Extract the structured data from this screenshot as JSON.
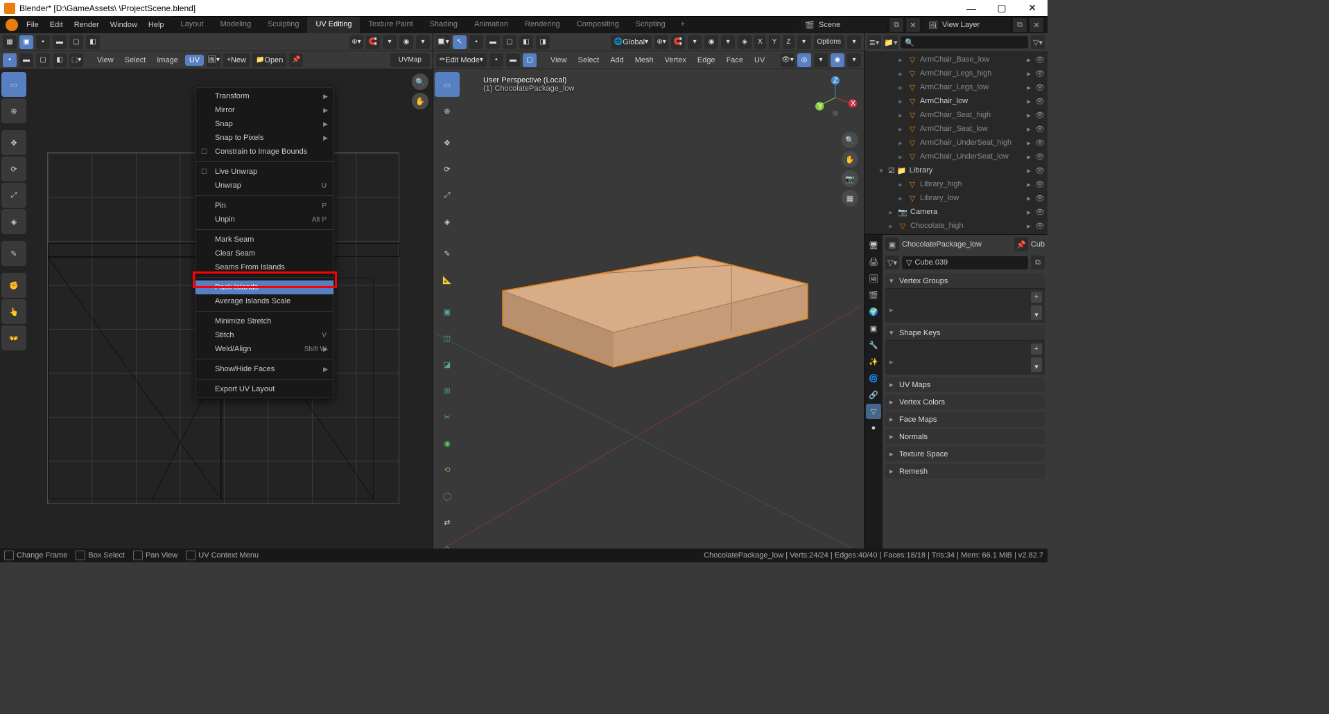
{
  "title": "Blender* [D:\\GameAssets\\                 \\ProjectScene.blend]",
  "window_controls": {
    "min": "—",
    "max": "▢",
    "close": "✕"
  },
  "main_menu": [
    "File",
    "Edit",
    "Render",
    "Window",
    "Help"
  ],
  "workspace_tabs": [
    "Layout",
    "Modeling",
    "Sculpting",
    "UV Editing",
    "Texture Paint",
    "Shading",
    "Animation",
    "Rendering",
    "Compositing",
    "Scripting"
  ],
  "workspace_active": "UV Editing",
  "scene_name": "Scene",
  "layer_name": "View Layer",
  "uv_header": {
    "menus": [
      "View",
      "Select",
      "Image",
      "UV"
    ],
    "new": "New",
    "open": "Open",
    "map": "UVMap"
  },
  "uv_dropdown": {
    "items": [
      {
        "label": "Transform",
        "sub": true
      },
      {
        "label": "Mirror",
        "sub": true
      },
      {
        "label": "Snap",
        "sub": true
      },
      {
        "label": "Snap to Pixels",
        "sub": true
      },
      {
        "label": "Constrain to Image Bounds",
        "check": true
      },
      {
        "divider": true
      },
      {
        "label": "Live Unwrap",
        "check": true
      },
      {
        "label": "Unwrap",
        "shortcut": "U"
      },
      {
        "divider": true
      },
      {
        "label": "Pin",
        "shortcut": "P"
      },
      {
        "label": "Unpin",
        "shortcut": "Alt P"
      },
      {
        "divider": true
      },
      {
        "label": "Mark Seam"
      },
      {
        "label": "Clear Seam"
      },
      {
        "label": "Seams From Islands"
      },
      {
        "divider": true
      },
      {
        "label": "Pack Islands",
        "hl": true
      },
      {
        "label": "Average Islands Scale"
      },
      {
        "divider": true
      },
      {
        "label": "Minimize Stretch"
      },
      {
        "label": "Stitch",
        "shortcut": "V"
      },
      {
        "label": "Weld/Align",
        "shortcut": "Shift W",
        "sub": true
      },
      {
        "divider": true
      },
      {
        "label": "Show/Hide Faces",
        "sub": true
      },
      {
        "divider": true
      },
      {
        "label": "Export UV Layout"
      }
    ]
  },
  "vp_header": {
    "mode": "Edit Mode",
    "menus": [
      "View",
      "Select",
      "Add",
      "Mesh",
      "Vertex",
      "Edge",
      "Face",
      "UV"
    ],
    "orient": "Global",
    "options": "Options"
  },
  "vp_overlay": {
    "line1": "User Perspective (Local)",
    "line2": "(1) ChocolatePackage_low"
  },
  "outliner": {
    "items": [
      {
        "indent": 3,
        "label": "ArmChair_Base_low",
        "icons": true,
        "dim": true
      },
      {
        "indent": 3,
        "label": "ArmChair_Legs_high",
        "icons": true,
        "dim": true
      },
      {
        "indent": 3,
        "label": "ArmChair_Legs_low",
        "icons": true,
        "dim": true
      },
      {
        "indent": 3,
        "label": "ArmChair_low",
        "icons": true,
        "active": true
      },
      {
        "indent": 3,
        "label": "ArmChair_Seat_high",
        "icons": true,
        "dim": true
      },
      {
        "indent": 3,
        "label": "ArmChair_Seat_low",
        "icons": true,
        "dim": true
      },
      {
        "indent": 3,
        "label": "ArmChair_UnderSeat_high",
        "icons": true,
        "dim": true
      },
      {
        "indent": 3,
        "label": "ArmChair_UnderSeat_low",
        "icons": true,
        "dim": true
      },
      {
        "indent": 1,
        "label": "Library",
        "collection": true,
        "exp": true
      },
      {
        "indent": 3,
        "label": "Library_high",
        "icons": true,
        "dim": true
      },
      {
        "indent": 3,
        "label": "Library_low",
        "icons": true,
        "dim": true
      },
      {
        "indent": 2,
        "label": "Camera",
        "camera": true
      },
      {
        "indent": 2,
        "label": "Chocolate_high",
        "icons": true,
        "dim": true
      }
    ]
  },
  "props": {
    "object_name": "ChocolatePackage_low",
    "data_name": "Cube.039",
    "pin": "Cub",
    "sections": [
      {
        "label": "Vertex Groups",
        "open": true
      },
      {
        "label": "Shape Keys",
        "open": true
      },
      {
        "label": "UV Maps",
        "open": false
      },
      {
        "label": "Vertex Colors",
        "open": false
      },
      {
        "label": "Face Maps",
        "open": false
      },
      {
        "label": "Normals",
        "open": false
      },
      {
        "label": "Texture Space",
        "open": false
      },
      {
        "label": "Remesh",
        "open": false
      }
    ]
  },
  "status": {
    "left": [
      {
        "label": "Change Frame"
      },
      {
        "label": "Box Select"
      },
      {
        "label": "Pan View"
      },
      {
        "label": "UV Context Menu"
      }
    ],
    "right": "ChocolatePackage_low | Verts:24/24 | Edges:40/40 | Faces:18/18 | Tris:34 | Mem: 66.1 MiB | v2.82.7"
  }
}
